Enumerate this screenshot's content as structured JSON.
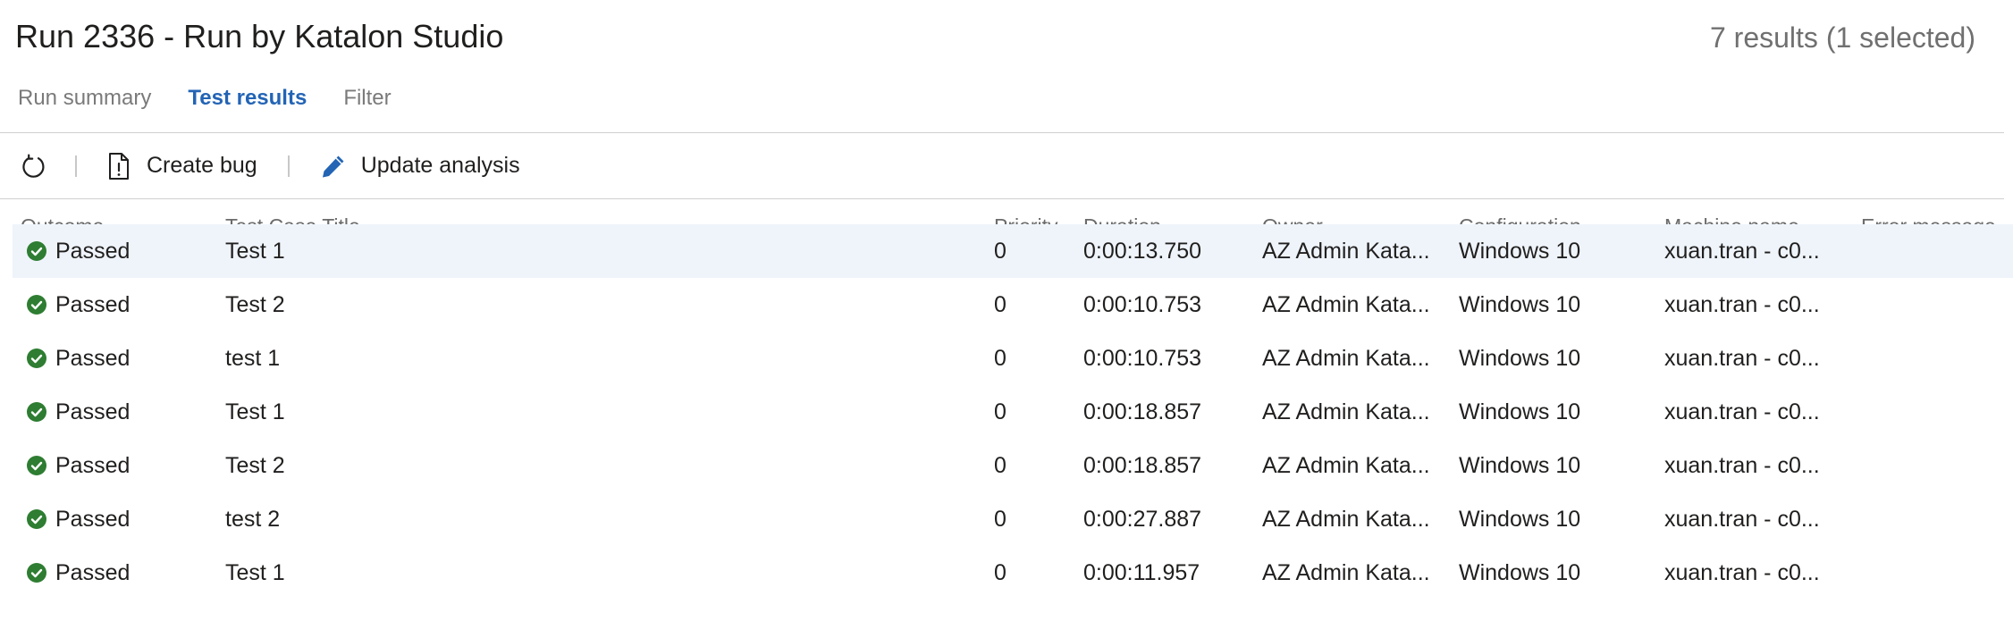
{
  "header": {
    "title": "Run 2336 - Run by Katalon Studio",
    "results_count": "7 results (1 selected)"
  },
  "tabs": [
    {
      "label": "Run summary",
      "active": false
    },
    {
      "label": "Test results",
      "active": true
    },
    {
      "label": "Filter",
      "active": false
    }
  ],
  "toolbar": {
    "refresh_icon": "refresh-icon",
    "create_bug_label": "Create bug",
    "create_bug_icon": "bug-document-icon",
    "update_analysis_label": "Update analysis",
    "update_analysis_icon": "pencil-icon"
  },
  "columns": {
    "outcome": "Outcome",
    "title": "Test Case Title",
    "priority": "Priority",
    "duration": "Duration",
    "owner": "Owner",
    "configuration": "Configuration",
    "machine": "Machine name",
    "error": "Error message"
  },
  "colors": {
    "accent": "#2364b5",
    "passed": "#2e7d32",
    "selected_row": "#eff4fb"
  },
  "rows": [
    {
      "outcome": "Passed",
      "title": "Test 1",
      "priority": "0",
      "duration": "0:00:13.750",
      "owner": "AZ Admin Kata...",
      "configuration": "Windows 10",
      "machine": "xuan.tran - c0...",
      "error": "",
      "selected": true
    },
    {
      "outcome": "Passed",
      "title": "Test 2",
      "priority": "0",
      "duration": "0:00:10.753",
      "owner": "AZ Admin Kata...",
      "configuration": "Windows 10",
      "machine": "xuan.tran - c0...",
      "error": "",
      "selected": false
    },
    {
      "outcome": "Passed",
      "title": "test 1",
      "priority": "0",
      "duration": "0:00:10.753",
      "owner": "AZ Admin Kata...",
      "configuration": "Windows 10",
      "machine": "xuan.tran - c0...",
      "error": "",
      "selected": false
    },
    {
      "outcome": "Passed",
      "title": "Test 1",
      "priority": "0",
      "duration": "0:00:18.857",
      "owner": "AZ Admin Kata...",
      "configuration": "Windows 10",
      "machine": "xuan.tran - c0...",
      "error": "",
      "selected": false
    },
    {
      "outcome": "Passed",
      "title": "Test 2",
      "priority": "0",
      "duration": "0:00:18.857",
      "owner": "AZ Admin Kata...",
      "configuration": "Windows 10",
      "machine": "xuan.tran - c0...",
      "error": "",
      "selected": false
    },
    {
      "outcome": "Passed",
      "title": "test 2",
      "priority": "0",
      "duration": "0:00:27.887",
      "owner": "AZ Admin Kata...",
      "configuration": "Windows 10",
      "machine": "xuan.tran - c0...",
      "error": "",
      "selected": false
    },
    {
      "outcome": "Passed",
      "title": "Test 1",
      "priority": "0",
      "duration": "0:00:11.957",
      "owner": "AZ Admin Kata...",
      "configuration": "Windows 10",
      "machine": "xuan.tran - c0...",
      "error": "",
      "selected": false
    }
  ]
}
